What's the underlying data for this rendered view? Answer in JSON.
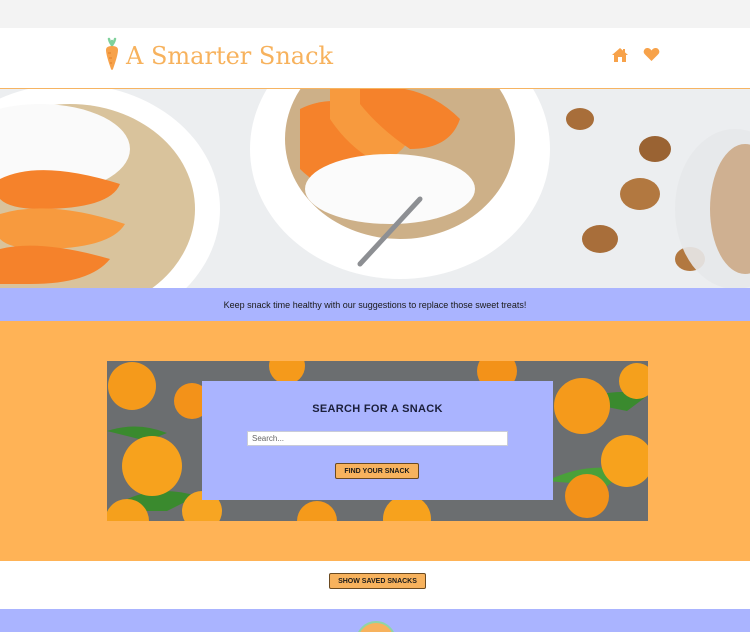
{
  "header": {
    "brand_title": "A Smarter Snack",
    "logo_icon": "carrot-icon",
    "nav_icons": [
      "home-icon",
      "heart-icon"
    ]
  },
  "tagline": "Keep snack time healthy with our suggestions to replace those sweet treats!",
  "search": {
    "title": "SEARCH FOR A SNACK",
    "placeholder": "Search...",
    "button_label": "FIND YOUR SNACK"
  },
  "saved": {
    "button_label": "SHOW SAVED SNACKS"
  },
  "colors": {
    "accent_orange": "#f7b25d",
    "section_orange": "#ffb356",
    "periwinkle": "#aab4ff"
  }
}
